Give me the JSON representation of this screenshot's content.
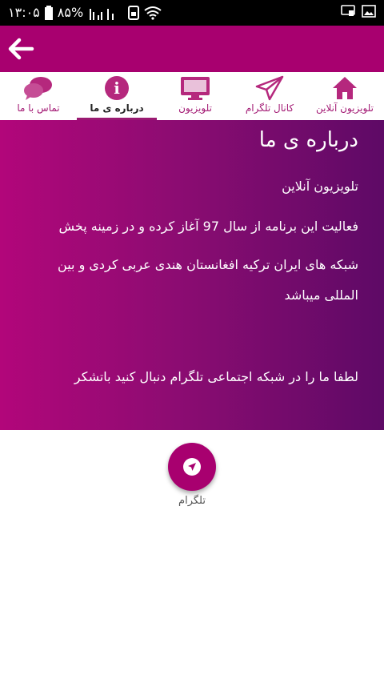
{
  "status": {
    "time": "۱۳:۰۵",
    "battery": "۸۵%"
  },
  "appbar": {
    "back_icon": "arrow-left-icon"
  },
  "tabs": [
    {
      "label": "تلویزیون آنلاین",
      "icon": "home-icon"
    },
    {
      "label": "کانال تلگرام",
      "icon": "paper-plane-icon"
    },
    {
      "label": "تلویزیون",
      "icon": "tv-icon"
    },
    {
      "label": "درباره ی ما",
      "icon": "info-icon",
      "active": true
    },
    {
      "label": "تماس با ما",
      "icon": "chat-icon"
    }
  ],
  "about": {
    "title": "درباره ی ما",
    "line1": "تلویزیون آنلاین",
    "line2": "فعالیت این برنامه از سال 97 آغاز کرده و در زمینه پخش",
    "line3": "شبکه های ایران ترکیه افغانستان هندی عربی کردی و بین المللی میباشد",
    "line4": "لطفا ما را در شبکه اجتماعی تلگرام دنبال کنید باتشکر"
  },
  "fab": {
    "label": "تلگرام",
    "icon": "navigation-arrow-icon"
  },
  "colors": {
    "primary": "#a8006f",
    "gradient_start": "#b2067a",
    "gradient_end": "#5e0a66",
    "tab_icon": "#b5287d"
  }
}
